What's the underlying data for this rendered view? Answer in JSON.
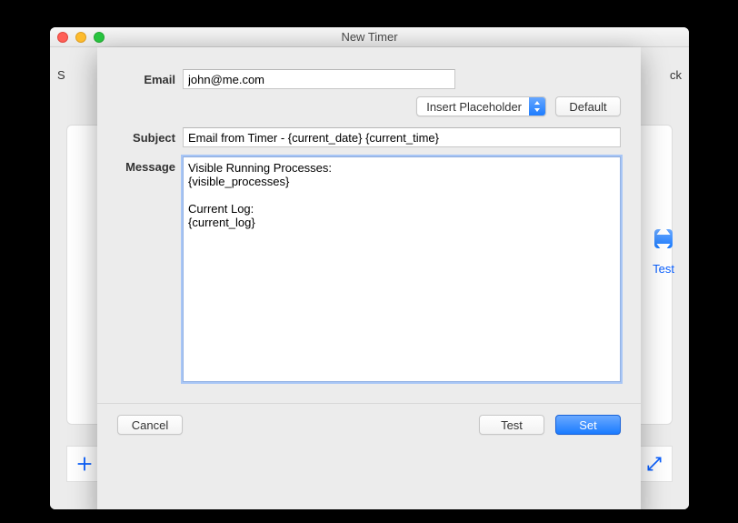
{
  "window": {
    "title": "New Timer"
  },
  "background": {
    "left_truncated": "S",
    "right_truncated": "ck",
    "test_link": "Test"
  },
  "form": {
    "email_label": "Email",
    "email_value": "john@me.com",
    "insert_placeholder_label": "Insert Placeholder",
    "default_button": "Default",
    "subject_label": "Subject",
    "subject_value": "Email from Timer - {current_date} {current_time}",
    "message_label": "Message",
    "message_value": "Visible Running Processes:\n{visible_processes}\n\nCurrent Log:\n{current_log}"
  },
  "buttons": {
    "cancel": "Cancel",
    "test": "Test",
    "set": "Set"
  }
}
